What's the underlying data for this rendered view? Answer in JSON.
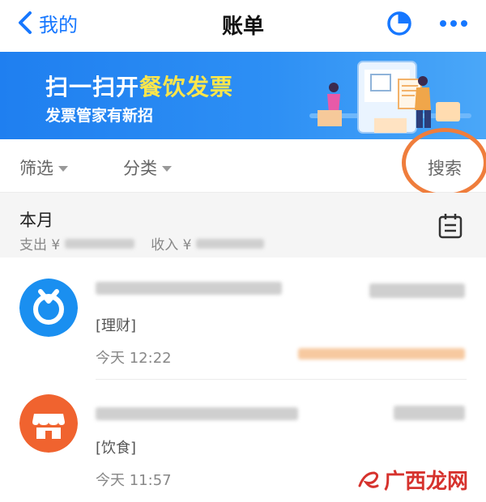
{
  "navbar": {
    "back_label": "我的",
    "title": "账单"
  },
  "banner": {
    "title_part1": "扫一扫开",
    "title_highlight": "餐饮发票",
    "subtitle": "发票管家有新招"
  },
  "filters": {
    "filter_label": "筛选",
    "category_label": "分类",
    "search_label": "搜索"
  },
  "month": {
    "title": "本月",
    "expense_label": "支出 ¥",
    "income_label": "收入 ¥"
  },
  "transactions": [
    {
      "tag": "[理财]",
      "time": "今天  12:22",
      "icon": "ant-fortune-icon"
    },
    {
      "tag": "[饮食]",
      "time": "今天  11:57",
      "icon": "store-icon"
    }
  ],
  "watermark": {
    "text": "广西龙网"
  },
  "colors": {
    "accent": "#1677ff",
    "banner": "#2d8ff4",
    "highlight": "#ffe64a",
    "ring": "#ef7d3c",
    "icon_blue": "#1a8ff0",
    "icon_orange": "#f0632f"
  }
}
